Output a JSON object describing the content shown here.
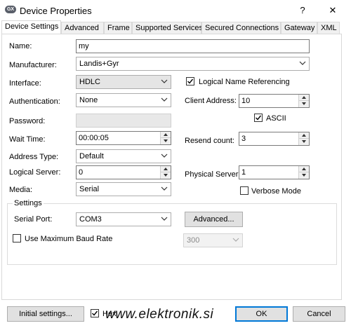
{
  "window": {
    "title": "Device Properties",
    "icon_text": "GX",
    "help_label": "?",
    "close_label": "✕"
  },
  "tabs": [
    {
      "label": "Device Settings"
    },
    {
      "label": "Advanced"
    },
    {
      "label": "Frame"
    },
    {
      "label": "Supported Services"
    },
    {
      "label": "Secured Connections"
    },
    {
      "label": "Gateway"
    },
    {
      "label": "XML"
    }
  ],
  "form": {
    "name_label": "Name:",
    "name_value": "my",
    "manufacturer_label": "Manufacturer:",
    "manufacturer_value": "Landis+Gyr",
    "interface_label": "Interface:",
    "interface_value": "HDLC",
    "logical_name_ref_label": "Logical Name Referencing",
    "logical_name_ref_checked": true,
    "authentication_label": "Authentication:",
    "authentication_value": "None",
    "client_address_label": "Client Address:",
    "client_address_value": "10",
    "password_label": "Password:",
    "password_value": "",
    "ascii_label": "ASCII",
    "ascii_checked": true,
    "wait_time_label": "Wait Time:",
    "wait_time_value": "00:00:05",
    "resend_count_label": "Resend count:",
    "resend_count_value": "3",
    "address_type_label": "Address Type:",
    "address_type_value": "Default",
    "logical_server_label": "Logical Server:",
    "logical_server_value": "0",
    "physical_server_label": "Physical Server:",
    "physical_server_value": "1",
    "media_label": "Media:",
    "media_value": "Serial",
    "verbose_mode_label": "Verbose Mode",
    "verbose_mode_checked": false
  },
  "settings": {
    "group_label": "Settings",
    "serial_port_label": "Serial Port:",
    "serial_port_value": "COM3",
    "advanced_button": "Advanced...",
    "max_baud_label": "Use Maximum Baud Rate",
    "max_baud_checked": false,
    "baud_value": "300"
  },
  "footer": {
    "initial_settings_button": "Initial settings...",
    "hex_label": "Hex",
    "hex_checked": true,
    "ok_button": "OK",
    "cancel_button": "Cancel"
  },
  "watermark": "www.elektronik.si"
}
